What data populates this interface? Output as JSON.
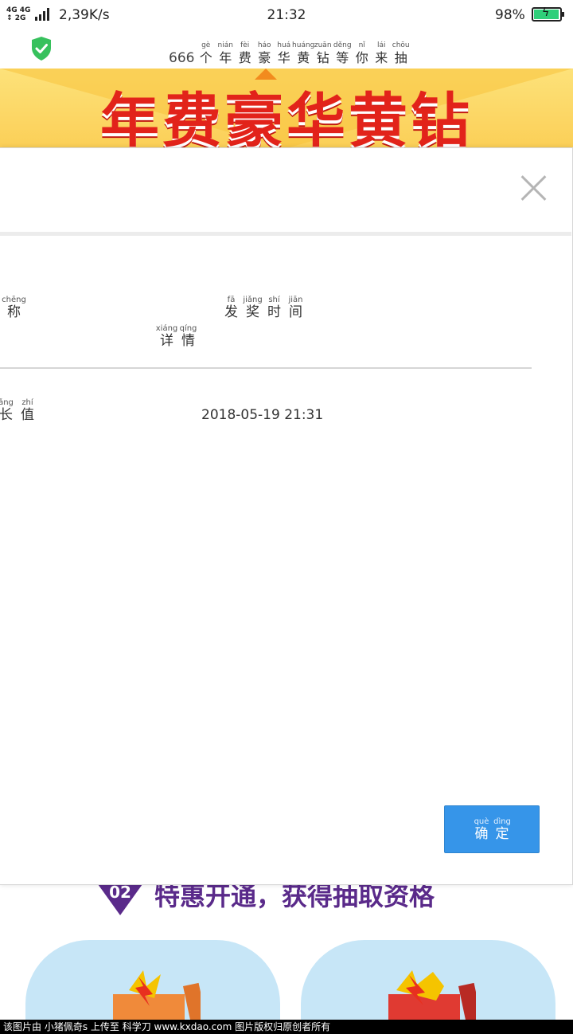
{
  "status_bar": {
    "network_top": "4G 4G",
    "network_bottom": "2G",
    "speed": "2,39K/s",
    "time": "21:32",
    "battery_percent_text": "98%",
    "battery_level": 0.98,
    "battery_color": "#2fcf7a"
  },
  "header": {
    "shield_icon": "shield-check-icon",
    "title_prefix": "666",
    "title_chars": [
      {
        "py": "gè",
        "hz": "个"
      },
      {
        "py": "nián",
        "hz": "年"
      },
      {
        "py": "fèi",
        "hz": "费"
      },
      {
        "py": "háo",
        "hz": "豪"
      },
      {
        "py": "huá",
        "hz": "华"
      },
      {
        "py": "huáng",
        "hz": "黄"
      },
      {
        "py": "zuān",
        "hz": "钻"
      },
      {
        "py": "děng",
        "hz": "等"
      },
      {
        "py": "nǐ",
        "hz": "你"
      },
      {
        "py": "lái",
        "hz": "来"
      },
      {
        "py": "chōu",
        "hz": "抽"
      }
    ]
  },
  "banner": {
    "text": "年费豪华黄钻",
    "color": "#e2231a"
  },
  "dialog": {
    "close_icon": "close-icon",
    "col_name": [
      {
        "py": "chēng",
        "hz": "称"
      }
    ],
    "col_time": [
      {
        "py": "fā",
        "hz": "发"
      },
      {
        "py": "jiǎng",
        "hz": "奖"
      },
      {
        "py": "shí",
        "hz": "时"
      },
      {
        "py": "jiān",
        "hz": "间"
      }
    ],
    "col_detail": [
      {
        "py": "xiáng",
        "hz": "详"
      },
      {
        "py": "qíng",
        "hz": "情"
      }
    ],
    "row": {
      "name": [
        {
          "py": "ǎng",
          "hz": "长"
        },
        {
          "py": "zhí",
          "hz": "值"
        }
      ],
      "time": "2018-05-19 21:31"
    },
    "confirm": [
      {
        "py": "què",
        "hz": "确"
      },
      {
        "py": "dìng",
        "hz": "定"
      }
    ],
    "confirm_color": "#3695e9"
  },
  "promo": {
    "badge": "02",
    "heading": "特惠开通，获得抽取资格"
  },
  "watermark": {
    "text": "该图片由 小猪佩奇s 上传至 科学刀 www.kxdao.com 图片版权归原创者所有"
  }
}
